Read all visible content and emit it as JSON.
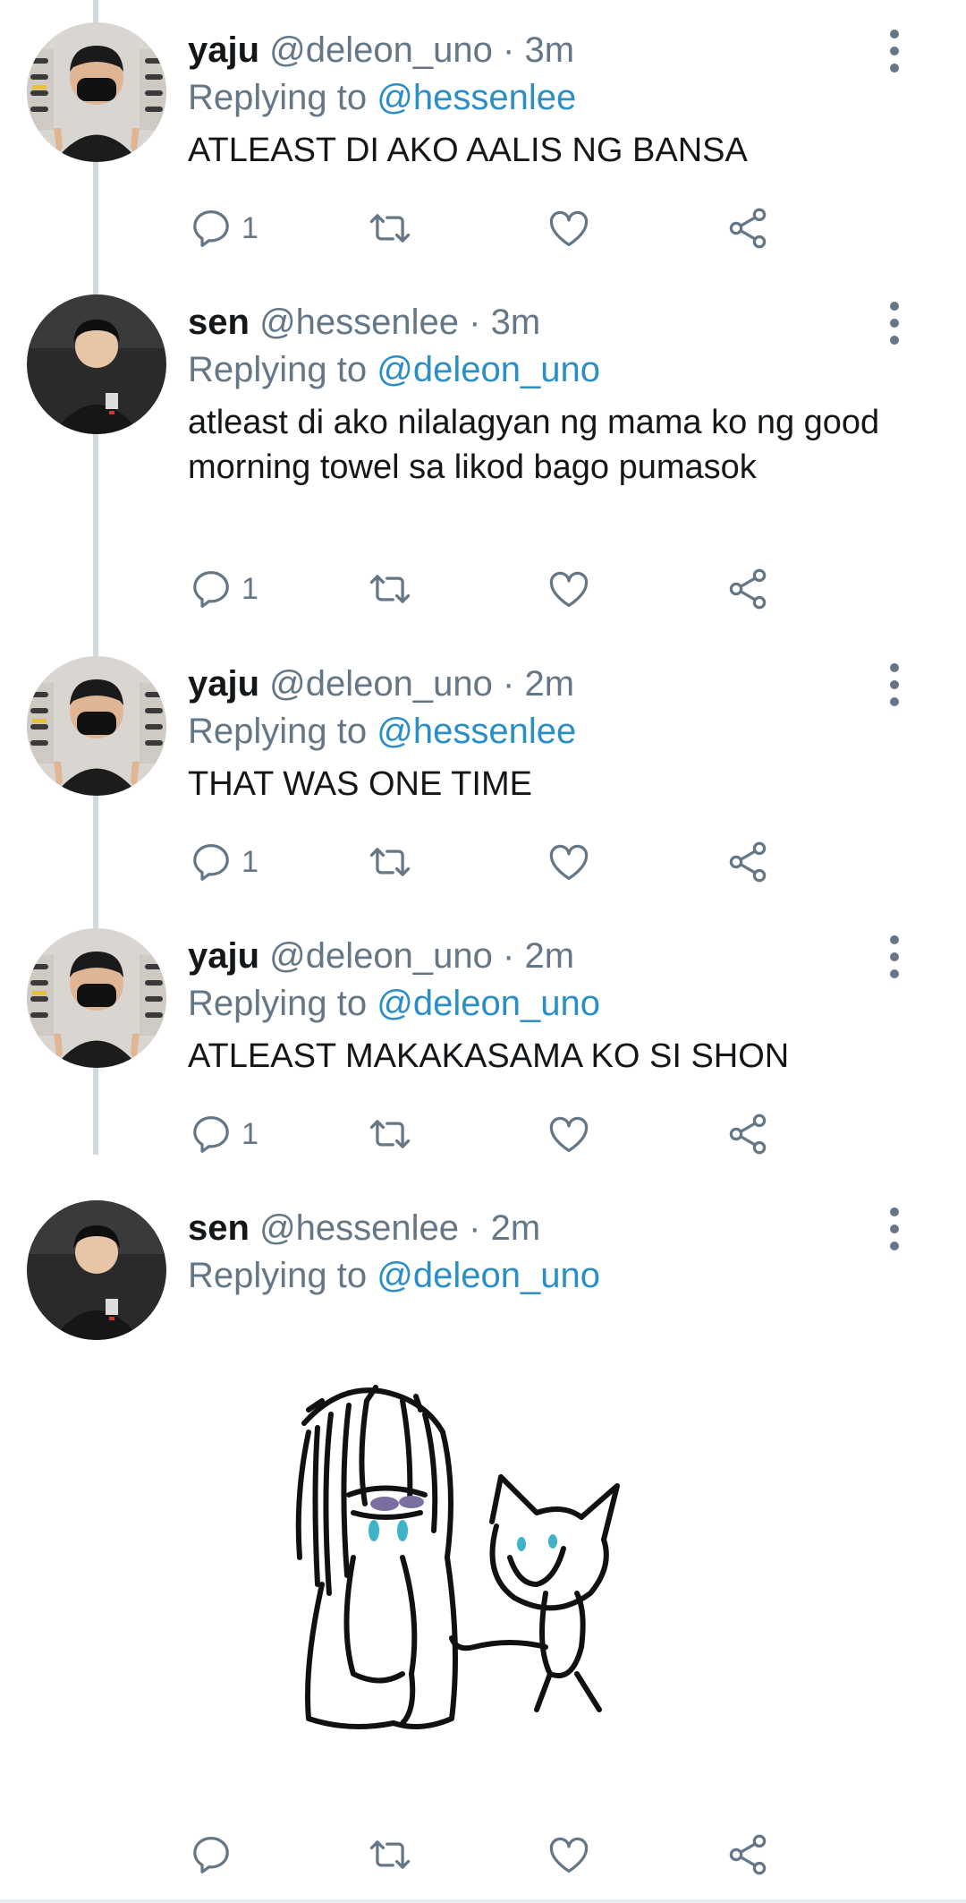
{
  "colors": {
    "accent": "#2b8fc6",
    "secondary_text": "#657786",
    "thread_line": "#cfd9de"
  },
  "tweets": [
    {
      "name": "yaju",
      "handle": "@deleon_uno",
      "separator": "·",
      "time": "3m",
      "replying_prefix": "Replying to",
      "replying_to": "@hessenlee",
      "text": "ATLEAST DI AKO AALIS NG BANSA",
      "reply_count": "1",
      "avatar": "masked-person-avatar"
    },
    {
      "name": "sen",
      "handle": "@hessenlee",
      "separator": "·",
      "time": "3m",
      "replying_prefix": "Replying to",
      "replying_to": "@deleon_uno",
      "text": "atleast di ako nilalagyan ng mama ko ng good morning towel sa likod bago pumasok",
      "reply_count": "1",
      "avatar": "dark-shirt-person-avatar"
    },
    {
      "name": "yaju",
      "handle": "@deleon_uno",
      "separator": "·",
      "time": "2m",
      "replying_prefix": "Replying to",
      "replying_to": "@hessenlee",
      "text": "THAT WAS ONE TIME",
      "reply_count": "1",
      "avatar": "masked-person-avatar"
    },
    {
      "name": "yaju",
      "handle": "@deleon_uno",
      "separator": "·",
      "time": "2m",
      "replying_prefix": "Replying to",
      "replying_to": "@deleon_uno",
      "text": "ATLEAST MAKAKASAMA KO SI SHON",
      "reply_count": "1",
      "avatar": "masked-person-avatar"
    },
    {
      "name": "sen",
      "handle": "@hessenlee",
      "separator": "·",
      "time": "2m",
      "replying_prefix": "Replying to",
      "replying_to": "@deleon_uno",
      "text": "",
      "reply_count": "",
      "avatar": "dark-shirt-person-avatar",
      "media": "crying-girl-and-cat-drawing"
    }
  ],
  "icons": {
    "reply": "reply-icon",
    "retweet": "retweet-icon",
    "like": "heart-icon",
    "share": "share-icon",
    "more": "more-vertical-icon"
  }
}
